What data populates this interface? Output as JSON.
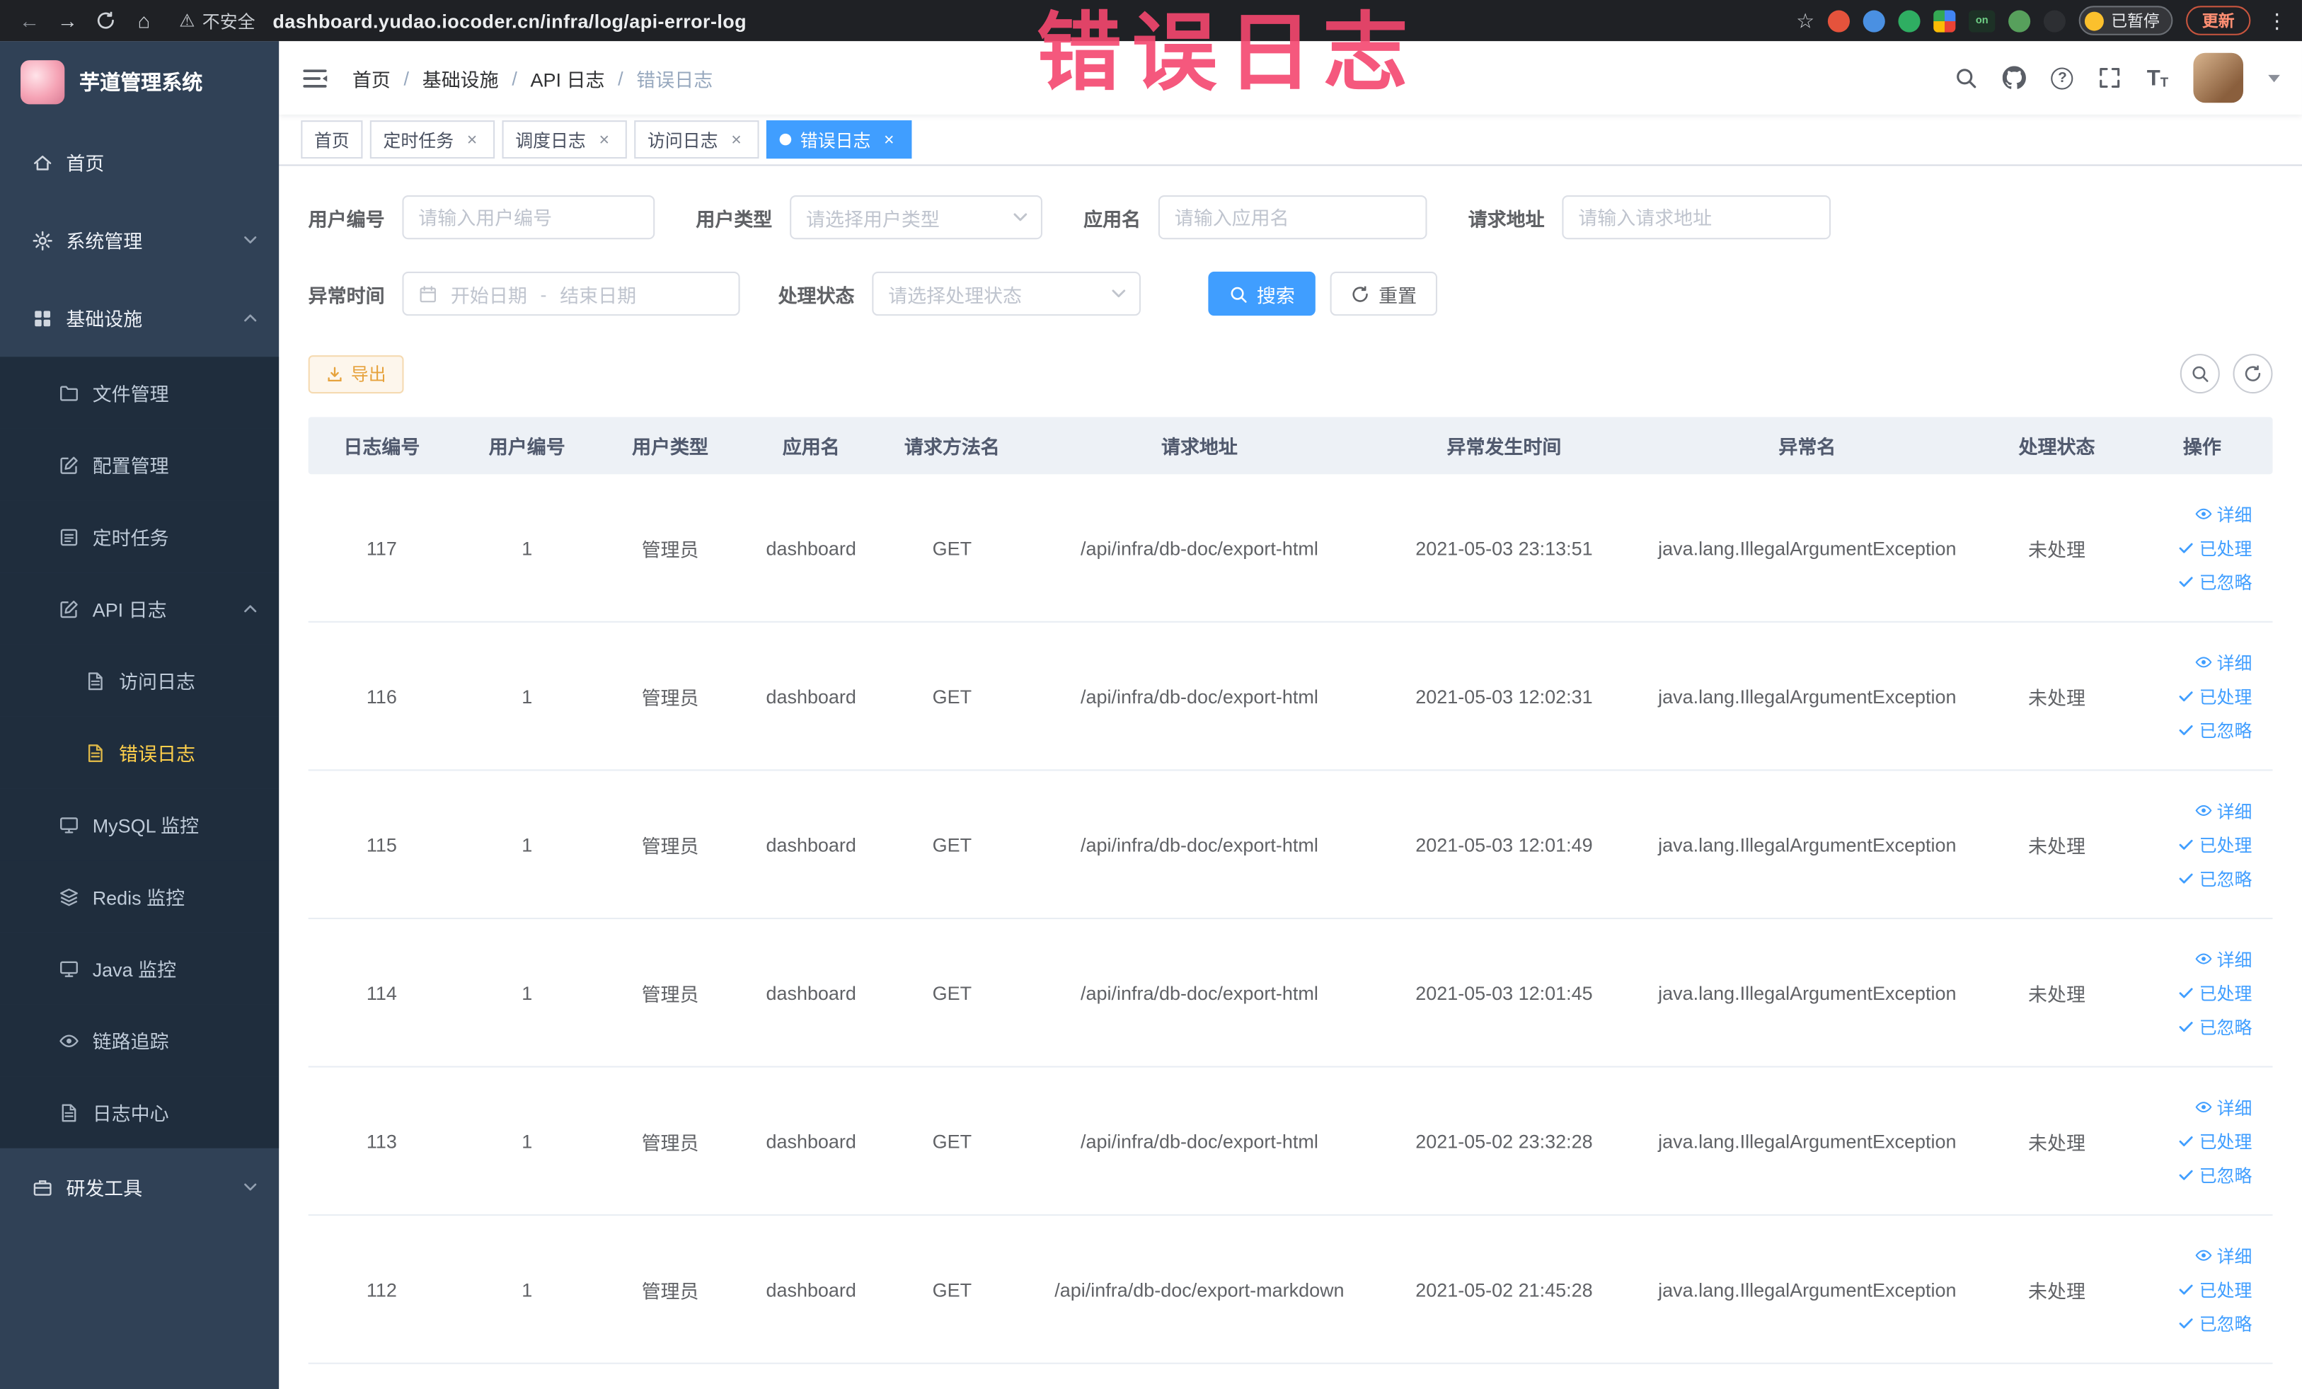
{
  "browser": {
    "security_label": "不安全",
    "url": "dashboard.yudao.iocoder.cn/infra/log/api-error-log",
    "profile_chip_label": "已暂停",
    "update_chip_label": "更新",
    "extension_on_badge": "on"
  },
  "icons": {
    "back": "←",
    "forward": "→",
    "home": "⌂",
    "warning": "⚠",
    "star": "☆",
    "kebab": "⋮",
    "close": "×",
    "question": "?",
    "font_size_large": "T",
    "font_size_small": "T"
  },
  "annotation": "错误日志",
  "sidebar": {
    "logo_title": "芋道管理系统",
    "items": [
      {
        "label": "首页"
      },
      {
        "label": "系统管理"
      },
      {
        "label": "基础设施"
      },
      {
        "label": "文件管理"
      },
      {
        "label": "配置管理"
      },
      {
        "label": "定时任务"
      },
      {
        "label": "API 日志"
      },
      {
        "label": "访问日志"
      },
      {
        "label": "错误日志"
      },
      {
        "label": "MySQL 监控"
      },
      {
        "label": "Redis 监控"
      },
      {
        "label": "Java 监控"
      },
      {
        "label": "链路追踪"
      },
      {
        "label": "日志中心"
      },
      {
        "label": "研发工具"
      }
    ]
  },
  "header": {
    "breadcrumb": [
      "首页",
      "基础设施",
      "API 日志",
      "错误日志"
    ],
    "separator": "/"
  },
  "tabs": [
    {
      "label": "首页"
    },
    {
      "label": "定时任务"
    },
    {
      "label": "调度日志"
    },
    {
      "label": "访问日志"
    },
    {
      "label": "错误日志"
    }
  ],
  "filters": {
    "user_id_label": "用户编号",
    "user_id_placeholder": "请输入用户编号",
    "user_type_label": "用户类型",
    "user_type_placeholder": "请选择用户类型",
    "app_name_label": "应用名",
    "app_name_placeholder": "请输入应用名",
    "request_url_label": "请求地址",
    "request_url_placeholder": "请输入请求地址",
    "exception_time_label": "异常时间",
    "date_start_placeholder": "开始日期",
    "date_separator": "-",
    "date_end_placeholder": "结束日期",
    "process_status_label": "处理状态",
    "process_status_placeholder": "请选择处理状态",
    "search_label": "搜索",
    "reset_label": "重置"
  },
  "toolbar": {
    "export_label": "导出"
  },
  "table": {
    "headers": [
      "日志编号",
      "用户编号",
      "用户类型",
      "应用名",
      "请求方法名",
      "请求地址",
      "异常发生时间",
      "异常名",
      "处理状态",
      "操作"
    ],
    "action_labels": {
      "detail": "详细",
      "processed": "已处理",
      "ignored": "已忽略"
    },
    "rows": [
      {
        "id": "117",
        "user_id": "1",
        "user_type": "管理员",
        "app_name": "dashboard",
        "method": "GET",
        "url": "/api/infra/db-doc/export-html",
        "time": "2021-05-03 23:13:51",
        "exception": "java.lang.IllegalArgumentException",
        "status": "未处理"
      },
      {
        "id": "116",
        "user_id": "1",
        "user_type": "管理员",
        "app_name": "dashboard",
        "method": "GET",
        "url": "/api/infra/db-doc/export-html",
        "time": "2021-05-03 12:02:31",
        "exception": "java.lang.IllegalArgumentException",
        "status": "未处理"
      },
      {
        "id": "115",
        "user_id": "1",
        "user_type": "管理员",
        "app_name": "dashboard",
        "method": "GET",
        "url": "/api/infra/db-doc/export-html",
        "time": "2021-05-03 12:01:49",
        "exception": "java.lang.IllegalArgumentException",
        "status": "未处理"
      },
      {
        "id": "114",
        "user_id": "1",
        "user_type": "管理员",
        "app_name": "dashboard",
        "method": "GET",
        "url": "/api/infra/db-doc/export-html",
        "time": "2021-05-03 12:01:45",
        "exception": "java.lang.IllegalArgumentException",
        "status": "未处理"
      },
      {
        "id": "113",
        "user_id": "1",
        "user_type": "管理员",
        "app_name": "dashboard",
        "method": "GET",
        "url": "/api/infra/db-doc/export-html",
        "time": "2021-05-02 23:32:28",
        "exception": "java.lang.IllegalArgumentException",
        "status": "未处理"
      },
      {
        "id": "112",
        "user_id": "1",
        "user_type": "管理员",
        "app_name": "dashboard",
        "method": "GET",
        "url": "/api/infra/db-doc/export-markdown",
        "time": "2021-05-02 21:45:28",
        "exception": "java.lang.IllegalArgumentException",
        "status": "未处理"
      }
    ]
  }
}
